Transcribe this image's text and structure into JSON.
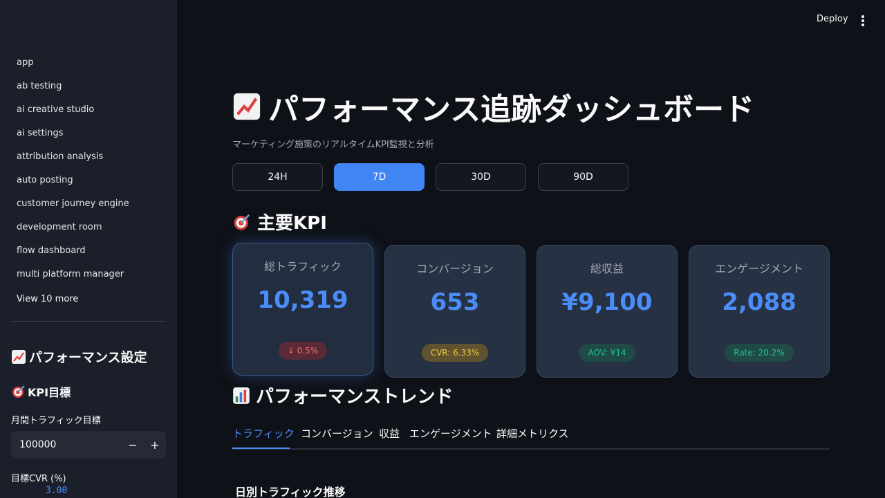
{
  "header": {
    "deploy_label": "Deploy"
  },
  "sidebar": {
    "nav_items": [
      {
        "label": "app"
      },
      {
        "label": "ab testing"
      },
      {
        "label": "ai creative studio"
      },
      {
        "label": "ai settings"
      },
      {
        "label": "attribution analysis"
      },
      {
        "label": "auto posting"
      },
      {
        "label": "customer journey engine"
      },
      {
        "label": "development room"
      },
      {
        "label": "flow dashboard"
      },
      {
        "label": "multi platform manager"
      }
    ],
    "view_more": "View 10 more",
    "settings_title": "パフォーマンス設定",
    "kpi_title": "KPI目標",
    "traffic_goal_label": "月間トラフィック目標",
    "traffic_goal_value": "100000",
    "cvr_label": "目標CVR (%)",
    "cvr_value": "3.00"
  },
  "main": {
    "title": "パフォーマンス追跡ダッシュボード",
    "subtitle": "マーケティング施策のリアルタイムKPI監視と分析",
    "periods": [
      {
        "label": "24H",
        "active": false
      },
      {
        "label": "7D",
        "active": true
      },
      {
        "label": "30D",
        "active": false
      },
      {
        "label": "90D",
        "active": false
      }
    ],
    "kpi_section_title": "主要KPI",
    "kpis": [
      {
        "label": "総トラフィック",
        "value": "10,319",
        "badge": "↓ 0.5%",
        "badge_color": "#f36b6b"
      },
      {
        "label": "コンバージョン",
        "value": "653",
        "badge": "CVR: 6.33%",
        "badge_color": "#f7c93c"
      },
      {
        "label": "総収益",
        "value": "¥9,100",
        "badge": "AOV: ¥14",
        "badge_color": "#23c48a"
      },
      {
        "label": "エンゲージメント",
        "value": "2,088",
        "badge": "Rate: 20.2%",
        "badge_color": "#23c48a"
      }
    ],
    "trend_section_title": "パフォーマンストレンド",
    "tabs": [
      {
        "label": "トラフィック",
        "active": true
      },
      {
        "label": "コンバージョン",
        "active": false
      },
      {
        "label": "収益",
        "active": false
      },
      {
        "label": "エンゲージメント",
        "active": false
      },
      {
        "label": "詳細メトリクス",
        "active": false
      }
    ],
    "chart_title": "日別トラフィック推移"
  },
  "colors": {
    "accent": "#4184f4",
    "value_blue": "#4b8df8",
    "background": "#0e1117",
    "sidebar": "#1b1f2a"
  },
  "icons": [
    "chart-increasing-icon",
    "target-icon",
    "bar-chart-icon",
    "kebab-menu-icon",
    "minus-icon",
    "plus-icon"
  ]
}
